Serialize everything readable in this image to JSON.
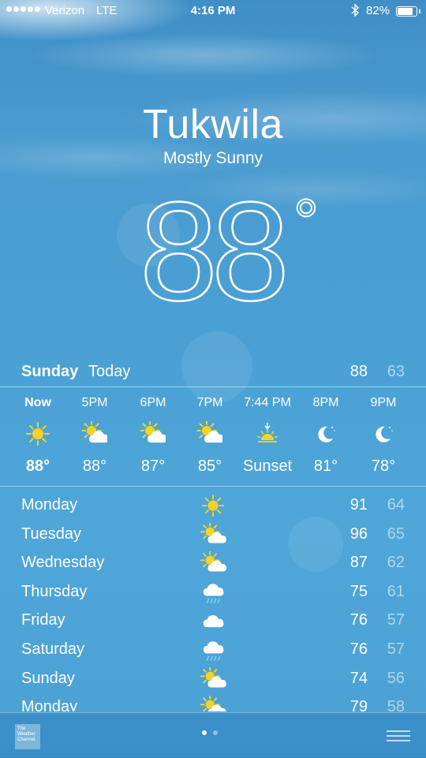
{
  "status_bar": {
    "carrier": "Verizon",
    "network": "LTE",
    "time": "4:16 PM",
    "bluetooth_icon": "bluetooth-icon",
    "battery_percent": "82%",
    "battery_level": 0.82
  },
  "header": {
    "city": "Tukwila",
    "condition": "Mostly Sunny",
    "temperature": "88",
    "degree": "°"
  },
  "today": {
    "day": "Sunday",
    "label": "Today",
    "high": "88",
    "low": "63"
  },
  "hourly": [
    {
      "time": "Now",
      "icon": "sun-icon",
      "temp": "88°"
    },
    {
      "time": "5PM",
      "icon": "partly-sunny-icon",
      "temp": "88°"
    },
    {
      "time": "6PM",
      "icon": "partly-sunny-icon",
      "temp": "87°"
    },
    {
      "time": "7PM",
      "icon": "partly-sunny-icon",
      "temp": "85°"
    },
    {
      "time": "7:44 PM",
      "icon": "sunset-icon",
      "temp": "Sunset"
    },
    {
      "time": "8PM",
      "icon": "moon-icon",
      "temp": "81°"
    },
    {
      "time": "9PM",
      "icon": "moon-icon",
      "temp": "78°"
    }
  ],
  "daily": [
    {
      "day": "Monday",
      "icon": "sun-icon",
      "high": "91",
      "low": "64"
    },
    {
      "day": "Tuesday",
      "icon": "partly-sunny-icon",
      "high": "96",
      "low": "65"
    },
    {
      "day": "Wednesday",
      "icon": "partly-sunny-icon",
      "high": "87",
      "low": "62"
    },
    {
      "day": "Thursday",
      "icon": "rain-icon",
      "high": "75",
      "low": "61"
    },
    {
      "day": "Friday",
      "icon": "cloud-icon",
      "high": "76",
      "low": "57"
    },
    {
      "day": "Saturday",
      "icon": "rain-icon",
      "high": "76",
      "low": "57"
    },
    {
      "day": "Sunday",
      "icon": "partly-sunny-icon",
      "high": "74",
      "low": "56"
    },
    {
      "day": "Monday",
      "icon": "partly-sunny-icon",
      "high": "79",
      "low": "58"
    }
  ],
  "footer": {
    "logo_text": "The Weather Channel",
    "page_count": 2,
    "active_page": 1,
    "list_icon": "list-icon"
  },
  "colors": {
    "sun": "#f7d325",
    "cloud": "#ffffff",
    "rain": "#7fd0ff",
    "secondary_text": "rgba(255,255,255,0.55)"
  }
}
